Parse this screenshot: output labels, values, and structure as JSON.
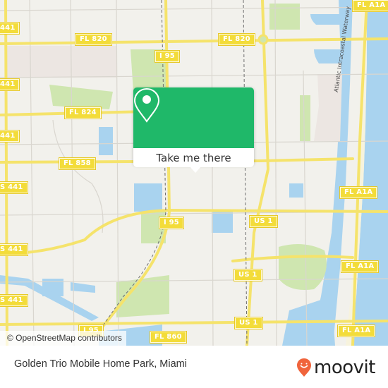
{
  "map": {
    "route_shields": [
      {
        "id": "fl820-left",
        "label": "FL 820"
      },
      {
        "id": "fl820-right",
        "label": "FL 820"
      },
      {
        "id": "i95-top",
        "label": "I 95"
      },
      {
        "id": "fl824",
        "label": "FL 824"
      },
      {
        "id": "fl858",
        "label": "FL 858"
      },
      {
        "id": "i95-mid",
        "label": "I 95"
      },
      {
        "id": "i95-bottom",
        "label": "I 95"
      },
      {
        "id": "fl860",
        "label": "FL 860"
      },
      {
        "id": "us441-1",
        "label": "441"
      },
      {
        "id": "us441-2",
        "label": "441"
      },
      {
        "id": "us441-3",
        "label": "441"
      },
      {
        "id": "us441-4",
        "label": "S 441"
      },
      {
        "id": "us441-5",
        "label": "S 441"
      },
      {
        "id": "us441-6",
        "label": "S 441"
      },
      {
        "id": "us1-a",
        "label": "US 1"
      },
      {
        "id": "us1-b",
        "label": "US 1"
      },
      {
        "id": "us1-c",
        "label": "US 1"
      },
      {
        "id": "fla1a-top",
        "label": "FL A1A"
      },
      {
        "id": "fla1a-2",
        "label": "FL A1A"
      },
      {
        "id": "fla1a-3",
        "label": "FL A1A"
      },
      {
        "id": "fla1a-4",
        "label": "FL A1A"
      }
    ],
    "waterway_label": "Atlantic Intracoastal Waterway",
    "attribution": "© OpenStreetMap contributors",
    "colors": {
      "land": "#f2f1ec",
      "water": "#a9d3ef",
      "park": "#cfe6b0",
      "road_major": "#f5e36b",
      "shield": "#f3dc3a",
      "popup_green": "#1fb869"
    }
  },
  "popup": {
    "icon": "location-pin-icon",
    "action_label": "Take me there"
  },
  "footer": {
    "place_title": "Golden Trio Mobile Home Park, Miami",
    "brand": "moovit",
    "brand_color": "#f0643c"
  }
}
